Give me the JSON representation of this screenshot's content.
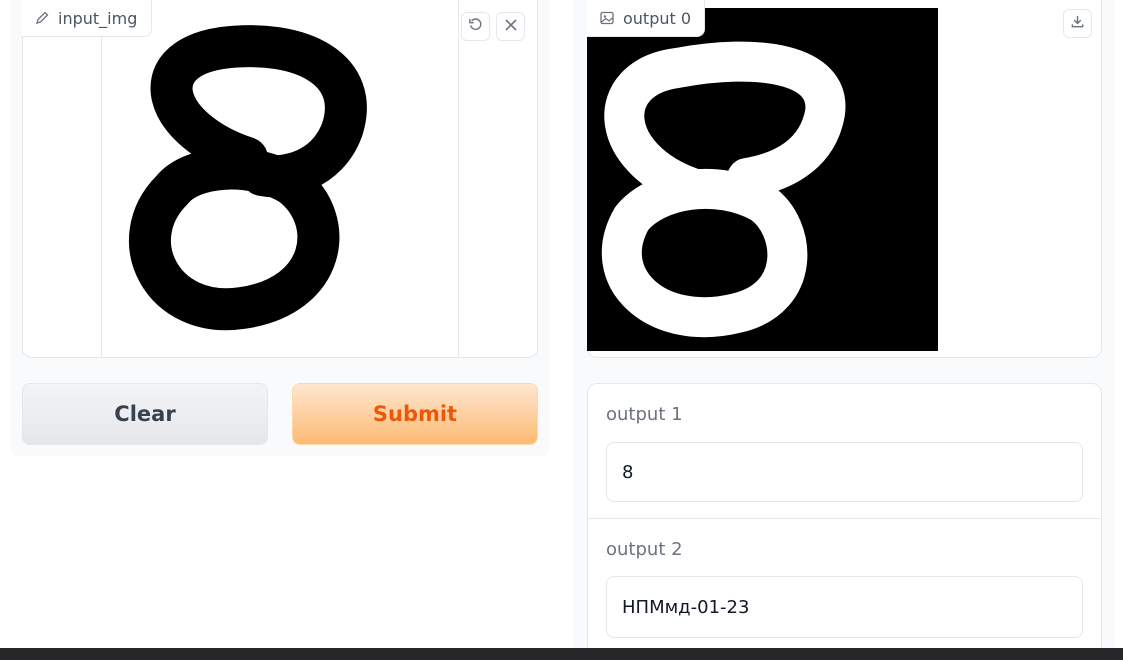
{
  "input": {
    "label": "input_img",
    "label_icon": "pencil-icon",
    "undo_icon": "undo-icon",
    "close_icon": "close-icon",
    "digit_style": "black handwritten 8 on white"
  },
  "actions": {
    "clear_label": "Clear",
    "submit_label": "Submit"
  },
  "output0": {
    "label": "output 0",
    "label_icon": "image-icon",
    "download_icon": "download-icon",
    "digit_style": "white handwritten 8 on black"
  },
  "output1": {
    "label": "output 1",
    "value": "8"
  },
  "output2": {
    "label": "output 2",
    "value": "НПМмд-01-23"
  },
  "colors": {
    "accent": "#ea580c",
    "submit_gradient_top": "#fee7cf",
    "submit_gradient_bottom": "#fdba74",
    "border": "#e5e7eb",
    "panel_bg": "#f9fafb"
  }
}
